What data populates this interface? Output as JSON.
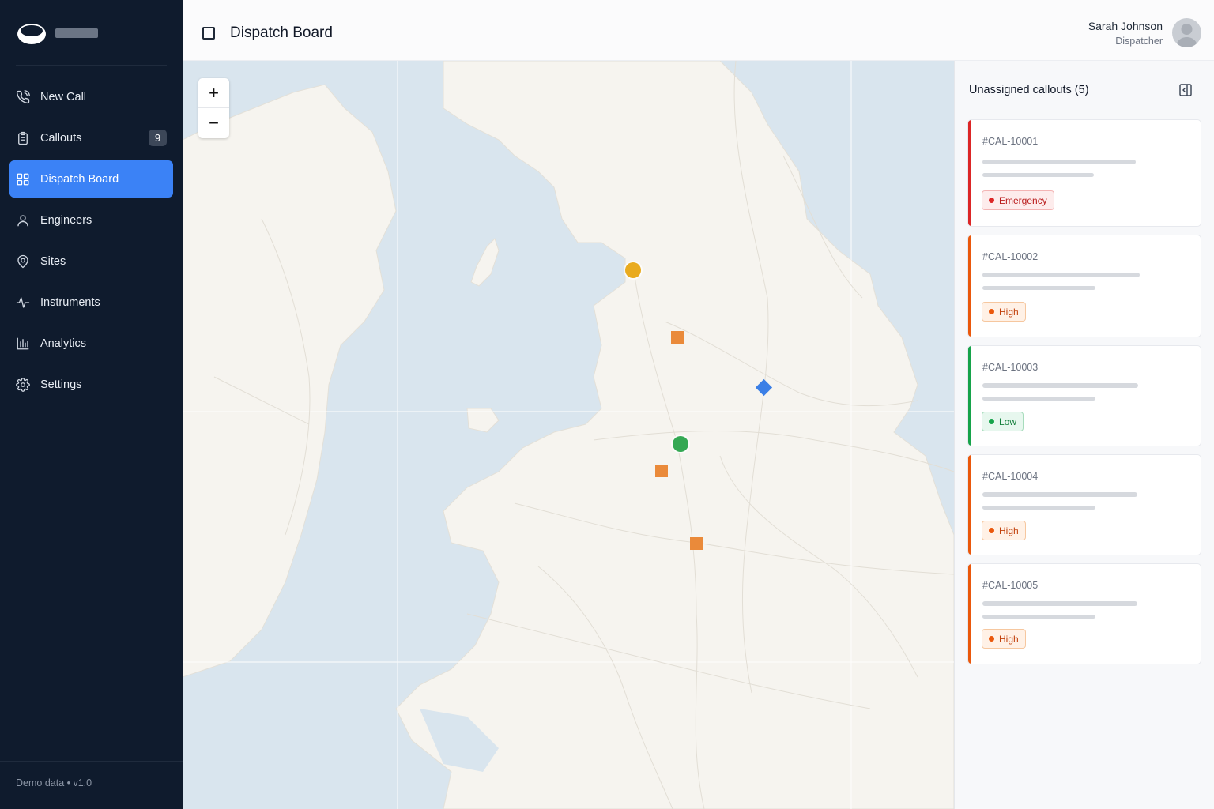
{
  "sidebar": {
    "items": [
      {
        "label": "New Call",
        "icon": "phone-icon"
      },
      {
        "label": "Callouts",
        "icon": "clipboard-icon",
        "badge": "9"
      },
      {
        "label": "Dispatch Board",
        "icon": "grid-icon",
        "active": true
      },
      {
        "label": "Engineers",
        "icon": "user-icon"
      },
      {
        "label": "Sites",
        "icon": "map-pin-icon"
      },
      {
        "label": "Instruments",
        "icon": "activity-icon"
      },
      {
        "label": "Analytics",
        "icon": "bar-chart-icon"
      },
      {
        "label": "Settings",
        "icon": "gear-icon"
      }
    ],
    "footer": "Demo data • v1.0"
  },
  "header": {
    "title": "Dispatch Board",
    "user_name": "Sarah Johnson",
    "user_role": "Dispatcher"
  },
  "map": {
    "zoom_in_label": "+",
    "zoom_out_label": "−",
    "markers": [
      {
        "shape": "circle",
        "color": "#e9ab1f"
      },
      {
        "shape": "square",
        "color": "#ea8a3a"
      },
      {
        "shape": "diamond",
        "color": "#3b7fe6"
      },
      {
        "shape": "circle",
        "color": "#34a853"
      },
      {
        "shape": "square",
        "color": "#ea8a3a"
      },
      {
        "shape": "square",
        "color": "#ea8a3a"
      }
    ]
  },
  "panel": {
    "title": "Unassigned callouts (5)",
    "callouts": [
      {
        "id": "#CAL-10001",
        "priority": "Emergency",
        "level": "emergency",
        "color": "#dc2626"
      },
      {
        "id": "#CAL-10002",
        "priority": "High",
        "level": "high",
        "color": "#ea580c"
      },
      {
        "id": "#CAL-10003",
        "priority": "Low",
        "level": "low",
        "color": "#16a34a"
      },
      {
        "id": "#CAL-10004",
        "priority": "High",
        "level": "high",
        "color": "#ea580c"
      },
      {
        "id": "#CAL-10005",
        "priority": "High",
        "level": "high",
        "color": "#ea580c"
      }
    ]
  },
  "colors": {
    "sidebar_bg": "#0f1b2d",
    "accent": "#3b82f6",
    "sea": "#d9e5ee",
    "land": "#f6f4ef"
  }
}
